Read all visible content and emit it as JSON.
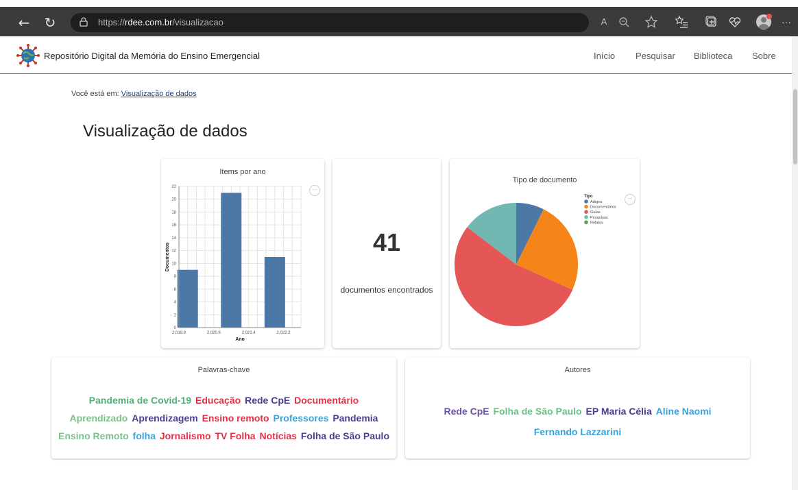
{
  "browser": {
    "url_prefix": "https://",
    "url_host": "rdee.com.br",
    "url_path": "/visualizacao",
    "read_aloud_label": "A",
    "more_label": "···"
  },
  "site": {
    "title": "Repositório Digital da Memória do Ensino Emergencial",
    "nav": [
      "Início",
      "Pesquisar",
      "Biblioteca",
      "Sobre"
    ]
  },
  "breadcrumb": {
    "prefix": "Você está em:",
    "current": "Visualização de dados"
  },
  "page_title": "Visualização de dados",
  "cards": {
    "items_por_ano": {
      "title": "Items por ano"
    },
    "count": {
      "value": "41",
      "caption": "documentos encontrados"
    },
    "tipo": {
      "title": "Tipo de documento"
    },
    "palavras": {
      "title": "Palavras-chave"
    },
    "autores": {
      "title": "Autores"
    }
  },
  "chart_data": [
    {
      "type": "bar",
      "title": "Items por ano",
      "xlabel": "Ano",
      "ylabel": "Documentos",
      "x_ticks": [
        "2,019.8",
        "2,020.6",
        "2,021.4",
        "2,022.2"
      ],
      "y_ticks": [
        0,
        2,
        4,
        6,
        8,
        10,
        12,
        14,
        16,
        18,
        20,
        22
      ],
      "categories": [
        2020,
        2021,
        2022
      ],
      "values": [
        9,
        21,
        11
      ],
      "ylim": [
        0,
        22
      ],
      "grid": true,
      "color": "#4c78a8"
    },
    {
      "type": "pie",
      "title": "Tipo de documento",
      "legend_title": "Tipo",
      "legend_position": "top-right",
      "labels": [
        "Artigos",
        "Documentários",
        "Guias",
        "Pesquisas",
        "Relatos"
      ],
      "values": [
        3,
        10,
        22,
        6,
        0
      ],
      "colors": [
        "#4c78a8",
        "#f58518",
        "#e45756",
        "#72b7b2",
        "#54a24b"
      ]
    }
  ],
  "keywords": [
    {
      "text": "Pandemia de Covid-19",
      "color": "#55b07a"
    },
    {
      "text": "Educação",
      "color": "#e0334a"
    },
    {
      "text": "Rede CpE",
      "color": "#4a3f8c"
    },
    {
      "text": "Documentário",
      "color": "#e0334a"
    },
    {
      "text": "Aprendizado",
      "color": "#7cc08a"
    },
    {
      "text": "Aprendizagem",
      "color": "#4a3f8c"
    },
    {
      "text": "Ensino remoto",
      "color": "#e0334a"
    },
    {
      "text": "Professores",
      "color": "#3ba3d8"
    },
    {
      "text": "Pandemia",
      "color": "#4a3f8c"
    },
    {
      "text": "Ensino Remoto",
      "color": "#7cc08a"
    },
    {
      "text": "folha",
      "color": "#3ba3d8"
    },
    {
      "text": "Jornalismo",
      "color": "#e0334a"
    },
    {
      "text": "TV Folha",
      "color": "#e0334a"
    },
    {
      "text": "Notícias",
      "color": "#e0334a"
    },
    {
      "text": "Folha de São Paulo",
      "color": "#4a3f8c"
    }
  ],
  "authors": [
    {
      "text": "Rede CpE",
      "color": "#6b52a8"
    },
    {
      "text": "Folha de São Paulo",
      "color": "#6cc08a"
    },
    {
      "text": "EP Maria Célia",
      "color": "#4a3f8c"
    },
    {
      "text": "Aline Naomi",
      "color": "#3ba3d8"
    },
    {
      "text": "Fernando Lazzarini",
      "color": "#3ba3d8"
    }
  ]
}
